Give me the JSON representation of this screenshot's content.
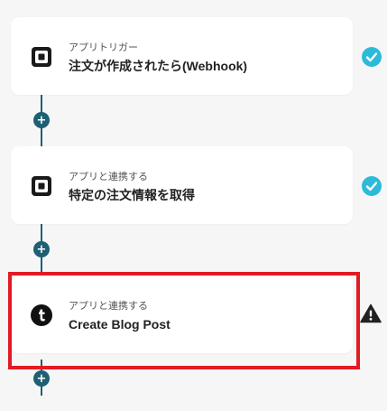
{
  "steps": [
    {
      "kind_label": "アプリトリガー",
      "title": "注文が作成されたら(Webhook)",
      "app_icon": "square-logo-icon",
      "status": "complete",
      "status_icon": "check-circle-icon"
    },
    {
      "kind_label": "アプリと連携する",
      "title": "特定の注文情報を取得",
      "app_icon": "square-logo-icon",
      "status": "complete",
      "status_icon": "check-circle-icon"
    },
    {
      "kind_label": "アプリと連携する",
      "title": "Create Blog Post",
      "app_icon": "tumblr-logo-icon",
      "status": "warning",
      "status_icon": "warning-triangle-icon",
      "highlighted": true
    }
  ],
  "add_step_symbol": "+",
  "colors": {
    "background": "#f6f6f6",
    "card": "#ffffff",
    "connector": "#1f5f73",
    "check": "#2bbbd8",
    "warning": "#222222",
    "highlight": "#e21b23"
  }
}
